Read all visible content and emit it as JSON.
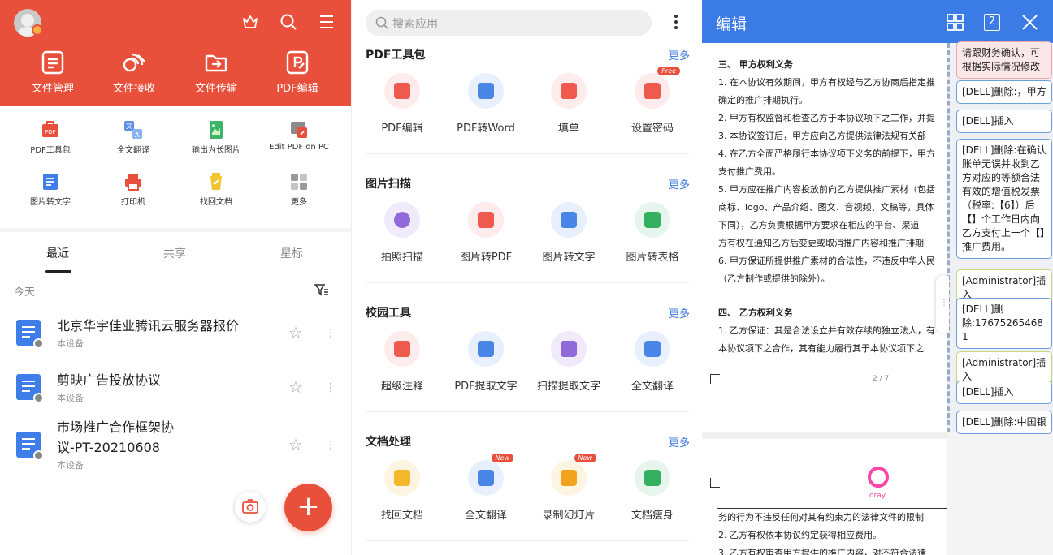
{
  "panel1": {
    "quick_actions": [
      {
        "label": "文件管理",
        "icon": "file-manage-icon"
      },
      {
        "label": "文件接收",
        "icon": "file-receive-icon"
      },
      {
        "label": "文件传输",
        "icon": "file-transfer-icon"
      },
      {
        "label": "PDF编辑",
        "icon": "pdf-edit-icon"
      }
    ],
    "tools_row1": [
      "PDF工具包",
      "全文翻译",
      "输出为长图片",
      "Edit PDF on PC"
    ],
    "tools_row2": [
      "图片转文字",
      "打印机",
      "找回文档",
      "更多"
    ],
    "tabs": [
      "最近",
      "共享",
      "星标"
    ],
    "section_label": "今天",
    "files": [
      {
        "title": "北京华宇佳业腾讯云服务器报价",
        "sub": "本设备"
      },
      {
        "title": "剪映广告投放协议",
        "sub": "本设备"
      },
      {
        "title_line1": "市场推广合作框架协",
        "title_line2": "议-PT-20210608",
        "sub": "本设备"
      }
    ],
    "fab_label": "+",
    "accent_color": "#e9503c"
  },
  "panel2": {
    "search_placeholder": "搜索应用",
    "sections": [
      {
        "title": "PDF工具包",
        "more": "更多",
        "apps": [
          {
            "label": "PDF编辑"
          },
          {
            "label": "PDF转Word"
          },
          {
            "label": "填单"
          },
          {
            "label": "设置密码",
            "badge": "Free"
          }
        ]
      },
      {
        "title": "图片扫描",
        "more": "更多",
        "apps": [
          {
            "label": "拍照扫描"
          },
          {
            "label": "图片转PDF"
          },
          {
            "label": "图片转文字"
          },
          {
            "label": "图片转表格"
          }
        ]
      },
      {
        "title": "校园工具",
        "more": "更多",
        "apps": [
          {
            "label": "超级注释"
          },
          {
            "label": "PDF提取文字"
          },
          {
            "label": "扫描提取文字"
          },
          {
            "label": "全文翻译"
          }
        ]
      },
      {
        "title": "文档处理",
        "more": "更多",
        "apps": [
          {
            "label": "找回文档"
          },
          {
            "label": "全文翻译",
            "badge": "New"
          },
          {
            "label": "录制幻灯片",
            "badge": "New"
          },
          {
            "label": "文档瘦身"
          }
        ]
      }
    ],
    "link_color": "#3a78e0"
  },
  "panel3": {
    "title": "编辑",
    "page_count_icon": "2",
    "doc_lines": [
      "三、    甲方权利义务",
      "1.  在本协议有效期间，甲方有权经与乙方协商后指定推",
      "     确定的推广排期执行。",
      "2.  甲方有权监督和检查乙方于本协议项下之工作，并提",
      "3.  本协议签订后，甲方应向乙方提供法律法规有关部",
      "4.  在乙方全面严格履行本协议项下义务的前提下，甲方",
      "     支付推广费用。",
      "5.  甲方应在推广内容投放前向乙方提供推广素材（包括",
      "     商标、logo、产品介绍、图文、音视频、文稿等，具体",
      "     下同），乙方负责根据甲方要求在相应的平台、渠道",
      "     方有权在通知乙方后变更或取消推广内容和推广排期",
      "6.  甲方保证所提供推广素材的合法性，不违反中华人民",
      "     （乙方制作或提供的除外）。",
      "四、    乙方权利义务",
      "1.  乙方保证：其是合法设立并有效存续的独立法人，有",
      "     本协议项下之合作，其有能力履行其于本协议项下之"
    ],
    "page_indicator": "2 / 7",
    "doc2_lines": [
      "     务的行为不违反任何对其有约束力的法律文件的限制",
      "2.  乙方有权依本协议约定获得相应费用。",
      "3.  乙方有权审查甲方提供的推广内容，对不符合法律"
    ],
    "logo_text": "oray",
    "comments": [
      {
        "text": "请跟财务确认，可根据实际情况修改",
        "style": "pink"
      },
      {
        "text": "[DELL]删除:，甲方",
        "style": "blue"
      },
      {
        "text": "[DELL]插入",
        "style": "blue"
      },
      {
        "text": "[DELL]删除:在确认账单无误并收到乙方对应的等额合法有效的增值税发票（税率:【6】）后【】个工作日内向乙方支付上一个【】推广费用。",
        "style": "blue"
      },
      {
        "text": "[Administrator]插入",
        "style": "green"
      },
      {
        "text": "[DELL]删除:17675265468 1",
        "style": "blue"
      },
      {
        "text": "[Administrator]插入",
        "style": "green"
      },
      {
        "text": "[DELL]插入",
        "style": "blue"
      },
      {
        "text": "[DELL]删除:中国银",
        "style": "blue"
      }
    ],
    "header_color": "#3a7be6"
  }
}
